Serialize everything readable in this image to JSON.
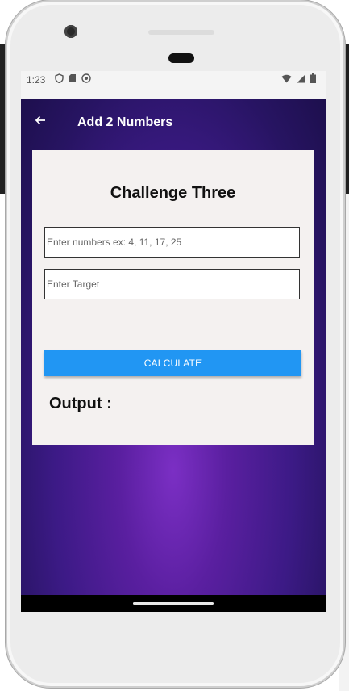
{
  "status_bar": {
    "time": "1:23"
  },
  "app_header": {
    "title": "Add 2 Numbers"
  },
  "card": {
    "title": "Challenge Three",
    "numbers_field": {
      "placeholder": "Enter numbers ex: 4, 11, 17, 25",
      "value": ""
    },
    "target_field": {
      "placeholder": "Enter Target",
      "value": ""
    },
    "calculate_label": "CALCULATE",
    "output_label": "Output :"
  },
  "colors": {
    "accent_button": "#2196f3",
    "background_purple": "#5a1fa0"
  }
}
